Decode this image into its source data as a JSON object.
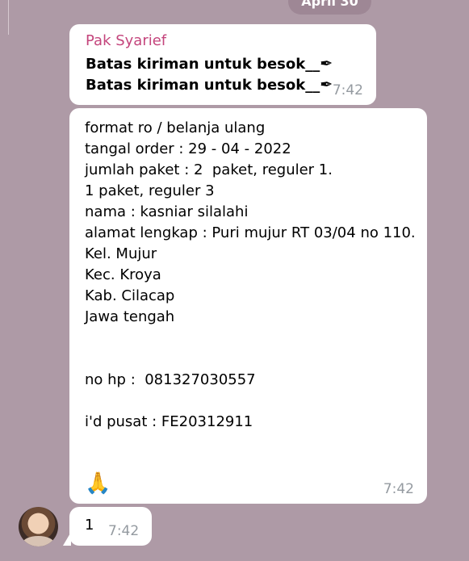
{
  "date_label": "April 30",
  "message1": {
    "sender": "Pak Syarief",
    "lines": [
      "Batas kiriman untuk besok__",
      "Batas kiriman untuk besok__"
    ],
    "time": "7:42"
  },
  "message2": {
    "text": "format ro / belanja ulang\ntangal order : 29 - 04 - 2022\njumlah paket : 2  paket, reguler 1.\n1 paket, reguler 3\nnama : kasniar silalahi\nalamat lengkap : Puri mujur RT 03/04 no 110.\nKel. Mujur\nKec. Kroya\nKab. Cilacap\nJawa tengah\n\n\nno hp :  081327030557\n\ni'd pusat : FE20312911",
    "emoji": "🙏",
    "time": "7:42"
  },
  "message3": {
    "text": "1",
    "time": "7:42"
  },
  "icons": {
    "pen": "pen-icon",
    "avatar": "avatar-image"
  },
  "colors": {
    "background": "#ae9aa6",
    "sender": "#c4457c",
    "time": "#949aa0"
  }
}
